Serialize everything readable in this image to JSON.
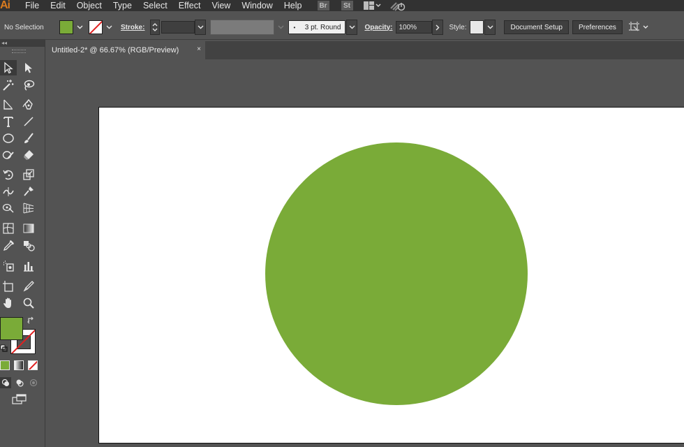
{
  "app": {
    "logo": "Ai",
    "menu": [
      "File",
      "Edit",
      "Object",
      "Type",
      "Select",
      "Effect",
      "View",
      "Window",
      "Help"
    ],
    "bridge_label": "Br",
    "stock_label": "St"
  },
  "control_bar": {
    "selection_status": "No Selection",
    "fill_color": "#7aab38",
    "stroke_label": "Stroke:",
    "brush_label": "3 pt. Round",
    "opacity_label": "Opacity:",
    "opacity_value": "100%",
    "style_label": "Style:",
    "document_setup_label": "Document Setup",
    "preferences_label": "Preferences"
  },
  "document": {
    "tab_title": "Untitled-2* @ 66.67% (RGB/Preview)",
    "close_glyph": "×"
  },
  "artwork": {
    "shape": "circle",
    "fill": "#7aab38"
  },
  "toolbar": {
    "collapse_glyph": "◂◂",
    "tools": [
      "selection-tool",
      "direct-selection-tool",
      "magic-wand-tool",
      "lasso-tool",
      "pen-tool",
      "curvature-tool",
      "type-tool",
      "line-segment-tool",
      "ellipse-tool",
      "paintbrush-tool",
      "shaper-tool",
      "eraser-tool",
      "rotate-tool",
      "scale-tool",
      "width-tool",
      "puppet-warp-tool",
      "shape-builder-tool",
      "perspective-grid-tool",
      "mesh-tool",
      "gradient-tool",
      "eyedropper-tool",
      "blend-tool",
      "symbol-sprayer-tool",
      "column-graph-tool",
      "artboard-tool",
      "slice-tool",
      "hand-tool",
      "zoom-tool"
    ]
  }
}
